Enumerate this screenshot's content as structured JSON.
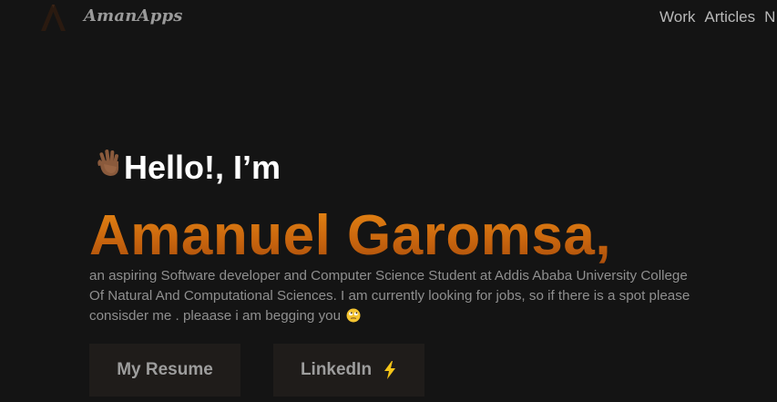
{
  "brand": {
    "name": "AmanApps",
    "logo_icon": "mountain-a-logo-icon"
  },
  "nav": {
    "links": [
      "Work",
      "Articles",
      "N"
    ]
  },
  "hero": {
    "wave_icon": "waving-hand-icon",
    "greeting": "Hello!, I’m",
    "name": "Amanuel Garomsa,",
    "bio": "an aspiring Software developer and Computer Science Student at Addis Ababa University College Of Natural And Computational Sciences. I am currently looking for jobs, so if there is a spot please consisder me . pleaase i am begging you",
    "bio_emoji_icon": "rolling-eyes-emoji-icon"
  },
  "buttons": {
    "resume_label": "My Resume",
    "linkedin_label": "LinkedIn",
    "linkedin_icon": "lightning-bolt-icon"
  },
  "colors": {
    "background": "#141414",
    "accent_orange": "#d4720f",
    "button_bg": "#1f1c1a",
    "bolt": "#f5c518"
  }
}
